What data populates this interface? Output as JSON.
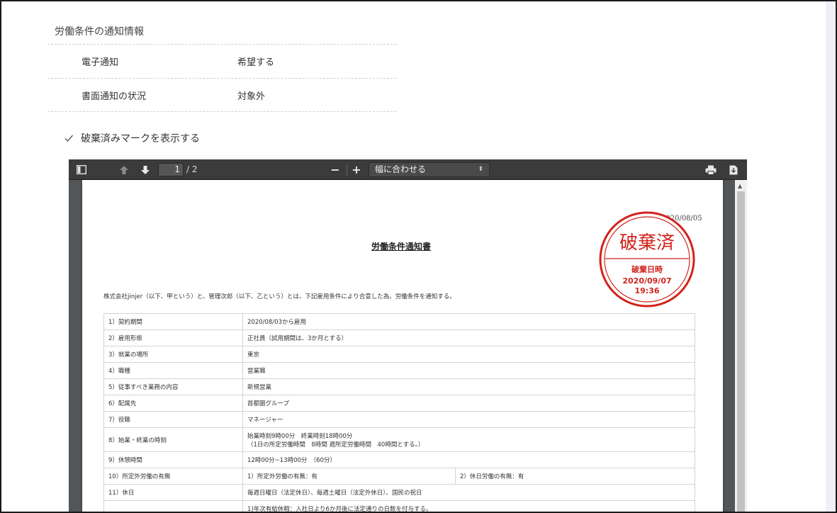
{
  "notice_section": {
    "title": "労働条件の通知情報",
    "rows": [
      {
        "label": "電子通知",
        "value": "希望する"
      },
      {
        "label": "書面通知の状況",
        "value": "対象外"
      }
    ]
  },
  "show_discard_mark": {
    "label": "破棄済みマークを表示する",
    "checked": true
  },
  "pdf_viewer": {
    "current_page": "1",
    "total_pages": "/ 2",
    "zoom_label": "幅に合わせる",
    "zoom_minus": "−",
    "zoom_plus": "+"
  },
  "document": {
    "date": "2020/08/05",
    "title": "労働条件通知書",
    "intro": "株式会社jinjer（以下、甲という）と、管理次郎（以下、乙という）とは、下記雇用条件により合意した為、労働条件を通知する。",
    "rows": [
      {
        "key": "1）契約期間",
        "value": "2020/08/03から雇用"
      },
      {
        "key": "2）雇用形態",
        "value": "正社員（試用期間は、3か月とする）"
      },
      {
        "key": "3）就業の場所",
        "value": "東京"
      },
      {
        "key": "4）職種",
        "value": "営業職"
      },
      {
        "key": "5）従事すべき業務の内容",
        "value": "新規営業"
      },
      {
        "key": "6）配属先",
        "value": "首都圏グループ"
      },
      {
        "key": "7）役職",
        "value": "マネージャー"
      },
      {
        "key": "8）始業・終業の時刻",
        "value": "始業時刻9時00分　終業時刻18時00分",
        "value2": "（1日の所定労働時間　8時間 週所定労働時間　40時間とする。）"
      },
      {
        "key": "9）休憩時間",
        "value": "12時00分~13時00分　（60分）"
      },
      {
        "key": "10）所定外労働の有無",
        "value": "1）所定外労働の有無：有",
        "value_b": "2）休日労働の有無：有"
      },
      {
        "key": "11）休日",
        "value": "毎週日曜日（法定休日）、毎週土曜日（法定外休日）、国民の祝日"
      },
      {
        "key": "",
        "value": "1)年次有給休暇：入社日より6か月後に法定通りの日数を付与する。"
      }
    ]
  },
  "stamp": {
    "main": "破棄済",
    "label": "破棄日時",
    "date": "2020/09/07",
    "time": "19:36",
    "color": "#d0231c"
  }
}
